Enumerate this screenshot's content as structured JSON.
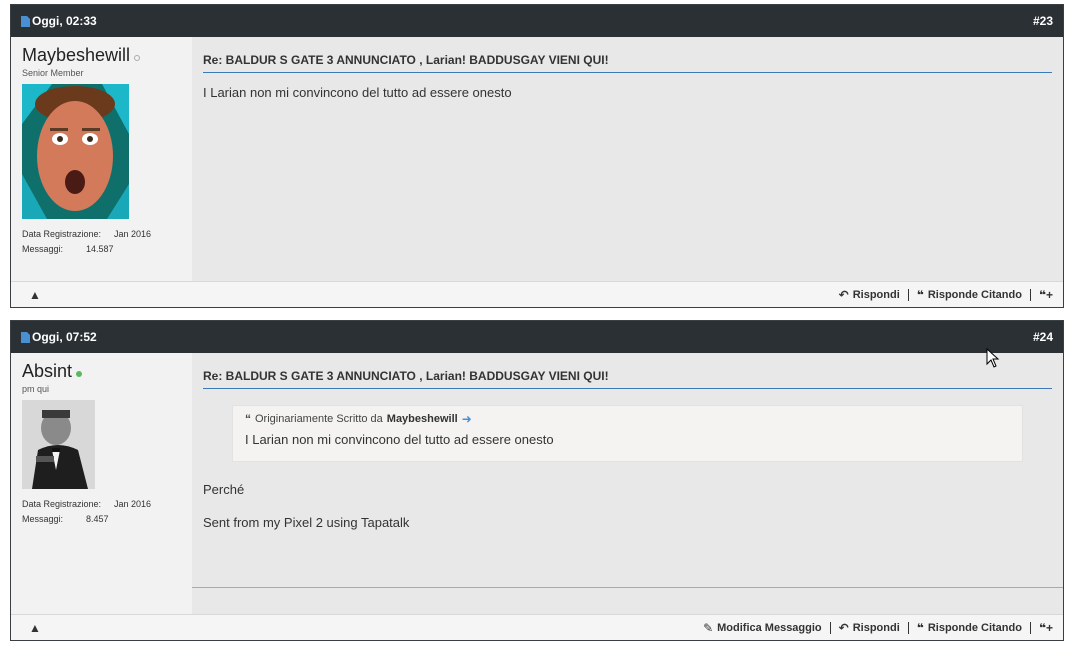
{
  "posts": [
    {
      "date": "Oggi, 02:33",
      "number": "#23",
      "username": "Maybeshewill",
      "status": "offline",
      "user_title": "Senior Member",
      "reg_label": "Data Registrazione:",
      "reg_value": "Jan 2016",
      "msg_label": "Messaggi:",
      "msg_value": "14.587",
      "title": "Re: BALDUR S GATE 3 ANNUNCIATO , Larian! BADDUSGAY VIENI QUI!",
      "text": "I Larian non mi convincono del tutto ad essere onesto",
      "reply_label": "Rispondi",
      "quote_reply_label": "Risponde Citando"
    },
    {
      "date": "Oggi, 07:52",
      "number": "#24",
      "username": "Absint",
      "status": "online",
      "user_title": "pm qui",
      "reg_label": "Data Registrazione:",
      "reg_value": "Jan 2016",
      "msg_label": "Messaggi:",
      "msg_value": "8.457",
      "title": "Re: BALDUR S GATE 3 ANNUNCIATO , Larian! BADDUSGAY VIENI QUI!",
      "quote_prefix": "Originariamente Scritto da",
      "quote_author": "Maybeshewill",
      "quote_text": "I Larian non mi convincono del tutto ad essere onesto",
      "text1": "Perché",
      "text2": "Sent from my Pixel 2 using Tapatalk",
      "edit_label": "Modifica Messaggio",
      "reply_label": "Rispondi",
      "quote_reply_label": "Risponde Citando"
    }
  ],
  "colors": {
    "header_bg": "#2b3035",
    "accent": "#3b7ab5",
    "online": "#5cb85c"
  },
  "icons": [
    "document-icon",
    "warning-icon",
    "reply-icon",
    "quote-reply-icon",
    "multi-quote-icon",
    "edit-icon",
    "quote-mark-icon",
    "view-post-arrow-icon"
  ]
}
